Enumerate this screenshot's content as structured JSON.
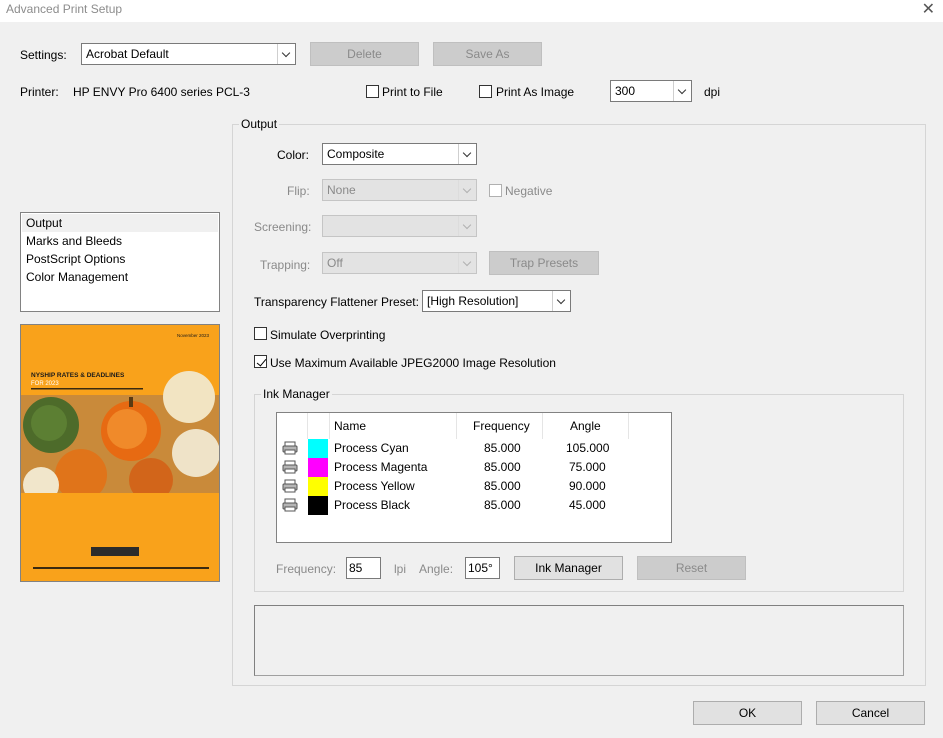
{
  "window": {
    "title": "Advanced Print Setup"
  },
  "settings": {
    "label": "Settings:",
    "value": "Acrobat Default",
    "delete_label": "Delete",
    "save_as_label": "Save As"
  },
  "printer": {
    "label": "Printer:",
    "name": "HP ENVY Pro 6400 series PCL-3",
    "print_to_file_label": "Print to File",
    "print_to_file": false,
    "print_as_image_label": "Print As Image",
    "print_as_image": false,
    "dpi_value": "300",
    "dpi_unit": "dpi"
  },
  "sidebar": {
    "items": [
      {
        "label": "Output",
        "selected": true
      },
      {
        "label": "Marks and Bleeds",
        "selected": false
      },
      {
        "label": "PostScript Options",
        "selected": false
      },
      {
        "label": "Color Management",
        "selected": false
      }
    ]
  },
  "preview": {
    "date_text": "November 2023",
    "heading": "NYSHIP RATES & DEADLINES",
    "subheading": "FOR 2023",
    "colors": {
      "background": "#f9a21b",
      "title": "#1a1a1a",
      "accent": "#ffffff"
    }
  },
  "output": {
    "group_title": "Output",
    "color_label": "Color:",
    "color_value": "Composite",
    "flip_label": "Flip:",
    "flip_value": "None",
    "negative_label": "Negative",
    "negative": false,
    "screening_label": "Screening:",
    "screening_value": "",
    "trapping_label": "Trapping:",
    "trapping_value": "Off",
    "trap_presets_label": "Trap Presets",
    "flattener_label": "Transparency Flattener Preset:",
    "flattener_value": "[High Resolution]",
    "simulate_overprinting_label": "Simulate Overprinting",
    "simulate_overprinting": false,
    "jpeg2000_label": "Use Maximum Available JPEG2000 Image Resolution",
    "jpeg2000": true
  },
  "ink_manager": {
    "group_title": "Ink Manager",
    "columns": [
      "Name",
      "Frequency",
      "Angle"
    ],
    "inks": [
      {
        "name": "Process Cyan",
        "frequency": "85.000",
        "angle": "105.000",
        "color": "#00ffff"
      },
      {
        "name": "Process Magenta",
        "frequency": "85.000",
        "angle": "75.000",
        "color": "#ff00ff"
      },
      {
        "name": "Process Yellow",
        "frequency": "85.000",
        "angle": "90.000",
        "color": "#ffff00"
      },
      {
        "name": "Process Black",
        "frequency": "85.000",
        "angle": "45.000",
        "color": "#000000"
      }
    ],
    "frequency_label": "Frequency:",
    "frequency_value": "85",
    "lpi_label": "lpi",
    "angle_label": "Angle:",
    "angle_value": "105°",
    "ink_manager_button": "Ink Manager",
    "reset_button": "Reset"
  },
  "footer": {
    "ok_label": "OK",
    "cancel_label": "Cancel"
  }
}
